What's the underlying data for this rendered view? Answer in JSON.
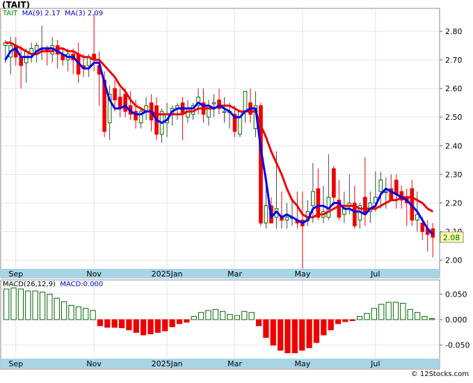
{
  "title": "(TAIT)",
  "price_legend": {
    "ticker": "TAIT",
    "ma_long_label": "MA(9)",
    "ma_long_value": "2.17",
    "ma_short_label": "MA(3)",
    "ma_short_value": "2.09"
  },
  "macd_legend": {
    "label": "MACD(26,12,9)",
    "value_label": "MACD:0.000"
  },
  "last_price": "2.08",
  "credit": "© 12Stocks.com",
  "colors": {
    "up": "#006600",
    "down": "#ee0000",
    "ma_short": "#0000ee",
    "ma_long": "#ee0000",
    "axis_band": "#a8d4e6",
    "label_box": "#ffffaa"
  },
  "chart_data": [
    {
      "type": "candlestick",
      "title": "(TAIT)",
      "ylim": [
        1.97,
        2.88
      ],
      "yticks": [
        "2.80",
        "2.70",
        "2.60",
        "2.50",
        "2.40",
        "2.30",
        "2.20",
        "2.10",
        "2.00"
      ],
      "xticks": [
        "Sep",
        "Nov",
        "2025Jan",
        "Mar",
        "May",
        "Jul"
      ],
      "xtick_index": [
        2,
        17,
        31,
        44,
        57,
        71
      ],
      "candles": [
        [
          2.75,
          2.77,
          2.69,
          2.76
        ],
        [
          2.71,
          2.78,
          2.65,
          2.75
        ],
        [
          2.75,
          2.78,
          2.68,
          2.71
        ],
        [
          2.71,
          2.75,
          2.6,
          2.68
        ],
        [
          2.69,
          2.74,
          2.62,
          2.73
        ],
        [
          2.72,
          2.76,
          2.69,
          2.74
        ],
        [
          2.72,
          2.76,
          2.69,
          2.75
        ],
        [
          2.74,
          2.82,
          2.7,
          2.74
        ],
        [
          2.74,
          2.75,
          2.68,
          2.73
        ],
        [
          2.72,
          2.78,
          2.69,
          2.75
        ],
        [
          2.75,
          2.77,
          2.67,
          2.72
        ],
        [
          2.72,
          2.74,
          2.68,
          2.7
        ],
        [
          2.7,
          2.74,
          2.66,
          2.72
        ],
        [
          2.72,
          2.74,
          2.65,
          2.7
        ],
        [
          2.72,
          2.76,
          2.62,
          2.65
        ],
        [
          2.68,
          2.72,
          2.64,
          2.67
        ],
        [
          2.68,
          2.72,
          2.64,
          2.71
        ],
        [
          2.72,
          2.86,
          2.66,
          2.7
        ],
        [
          2.68,
          2.73,
          2.54,
          2.65
        ],
        [
          2.63,
          2.66,
          2.43,
          2.45
        ],
        [
          2.48,
          2.61,
          2.42,
          2.58
        ],
        [
          2.6,
          2.63,
          2.52,
          2.56
        ],
        [
          2.57,
          2.6,
          2.5,
          2.53
        ],
        [
          2.58,
          2.6,
          2.5,
          2.52
        ],
        [
          2.54,
          2.59,
          2.49,
          2.51
        ],
        [
          2.52,
          2.56,
          2.46,
          2.49
        ],
        [
          2.48,
          2.53,
          2.46,
          2.52
        ],
        [
          2.52,
          2.57,
          2.49,
          2.54
        ],
        [
          2.55,
          2.58,
          2.45,
          2.49
        ],
        [
          2.54,
          2.57,
          2.42,
          2.44
        ],
        [
          2.44,
          2.53,
          2.41,
          2.52
        ],
        [
          2.48,
          2.55,
          2.43,
          2.51
        ],
        [
          2.51,
          2.54,
          2.47,
          2.53
        ],
        [
          2.53,
          2.55,
          2.49,
          2.54
        ],
        [
          2.55,
          2.57,
          2.42,
          2.51
        ],
        [
          2.5,
          2.56,
          2.48,
          2.53
        ],
        [
          2.51,
          2.55,
          2.49,
          2.54
        ],
        [
          2.54,
          2.6,
          2.51,
          2.57
        ],
        [
          2.55,
          2.6,
          2.48,
          2.51
        ],
        [
          2.5,
          2.56,
          2.47,
          2.54
        ],
        [
          2.55,
          2.58,
          2.5,
          2.55
        ],
        [
          2.56,
          2.6,
          2.51,
          2.53
        ],
        [
          2.52,
          2.57,
          2.48,
          2.52
        ],
        [
          2.52,
          2.55,
          2.46,
          2.52
        ],
        [
          2.51,
          2.54,
          2.43,
          2.45
        ],
        [
          2.44,
          2.52,
          2.43,
          2.52
        ],
        [
          2.52,
          2.59,
          2.48,
          2.59
        ],
        [
          2.55,
          2.6,
          2.48,
          2.51
        ],
        [
          2.46,
          2.59,
          2.43,
          2.54
        ],
        [
          2.54,
          2.55,
          2.12,
          2.13
        ],
        [
          2.13,
          2.3,
          2.11,
          2.19
        ],
        [
          2.19,
          2.22,
          2.13,
          2.13
        ],
        [
          2.15,
          2.38,
          2.11,
          2.18
        ],
        [
          2.15,
          2.24,
          2.11,
          2.14
        ],
        [
          2.14,
          2.2,
          2.11,
          2.15
        ],
        [
          2.15,
          2.21,
          2.12,
          2.15
        ],
        [
          2.14,
          2.24,
          2.11,
          2.13
        ],
        [
          2.14,
          2.24,
          1.97,
          2.12
        ],
        [
          2.14,
          2.21,
          2.12,
          2.17
        ],
        [
          2.19,
          2.34,
          2.13,
          2.24
        ],
        [
          2.25,
          2.32,
          2.14,
          2.15
        ],
        [
          2.15,
          2.26,
          2.13,
          2.17
        ],
        [
          2.15,
          2.37,
          2.14,
          2.22
        ],
        [
          2.32,
          2.33,
          2.19,
          2.22
        ],
        [
          2.21,
          2.28,
          2.14,
          2.15
        ],
        [
          2.16,
          2.24,
          2.13,
          2.18
        ],
        [
          2.19,
          2.3,
          2.16,
          2.2
        ],
        [
          2.2,
          2.26,
          2.11,
          2.12
        ],
        [
          2.14,
          2.2,
          2.11,
          2.19
        ],
        [
          2.22,
          2.36,
          2.12,
          2.16
        ],
        [
          2.17,
          2.24,
          2.13,
          2.2
        ],
        [
          2.2,
          2.31,
          2.17,
          2.22
        ],
        [
          2.24,
          2.31,
          2.18,
          2.28
        ],
        [
          2.24,
          2.29,
          2.18,
          2.24
        ],
        [
          2.25,
          2.3,
          2.21,
          2.21
        ],
        [
          2.28,
          2.3,
          2.18,
          2.23
        ],
        [
          2.24,
          2.26,
          2.18,
          2.21
        ],
        [
          2.22,
          2.25,
          2.12,
          2.2
        ],
        [
          2.25,
          2.28,
          2.12,
          2.14
        ],
        [
          2.14,
          2.24,
          2.1,
          2.16
        ],
        [
          2.13,
          2.15,
          2.07,
          2.1
        ],
        [
          2.11,
          2.14,
          2.03,
          2.09
        ],
        [
          2.11,
          2.13,
          2.01,
          2.08
        ]
      ],
      "ma_short": [
        2.7,
        2.73,
        2.74,
        2.71,
        2.71,
        2.71,
        2.73,
        2.74,
        2.74,
        2.74,
        2.73,
        2.72,
        2.71,
        2.71,
        2.69,
        2.67,
        2.67,
        2.69,
        2.69,
        2.62,
        2.56,
        2.53,
        2.53,
        2.54,
        2.52,
        2.51,
        2.51,
        2.52,
        2.52,
        2.49,
        2.48,
        2.49,
        2.52,
        2.53,
        2.53,
        2.53,
        2.53,
        2.55,
        2.54,
        2.54,
        2.53,
        2.54,
        2.53,
        2.52,
        2.5,
        2.5,
        2.52,
        2.53,
        2.53,
        2.39,
        2.28,
        2.15,
        2.17,
        2.15,
        2.16,
        2.15,
        2.14,
        2.13,
        2.14,
        2.18,
        2.19,
        2.19,
        2.18,
        2.2,
        2.2,
        2.18,
        2.18,
        2.17,
        2.17,
        2.16,
        2.18,
        2.19,
        2.23,
        2.25,
        2.24,
        2.23,
        2.22,
        2.21,
        2.19,
        2.17,
        2.14,
        2.11,
        2.09
      ],
      "ma_long": [
        2.76,
        2.76,
        2.75,
        2.74,
        2.73,
        2.72,
        2.72,
        2.73,
        2.73,
        2.73,
        2.74,
        2.74,
        2.73,
        2.73,
        2.72,
        2.71,
        2.71,
        2.7,
        2.7,
        2.68,
        2.66,
        2.64,
        2.61,
        2.59,
        2.56,
        2.54,
        2.53,
        2.52,
        2.52,
        2.51,
        2.51,
        2.51,
        2.51,
        2.51,
        2.51,
        2.52,
        2.52,
        2.53,
        2.53,
        2.53,
        2.53,
        2.54,
        2.54,
        2.54,
        2.53,
        2.52,
        2.52,
        2.52,
        2.52,
        2.47,
        2.43,
        2.38,
        2.34,
        2.3,
        2.25,
        2.21,
        2.19,
        2.16,
        2.15,
        2.15,
        2.16,
        2.16,
        2.17,
        2.18,
        2.19,
        2.19,
        2.19,
        2.19,
        2.18,
        2.18,
        2.18,
        2.18,
        2.19,
        2.2,
        2.21,
        2.21,
        2.22,
        2.22,
        2.22,
        2.21,
        2.2,
        2.18,
        2.17
      ]
    },
    {
      "type": "bar",
      "title": "MACD(26,12,9)",
      "ylim": [
        -0.075,
        0.075
      ],
      "yticks": [
        "0.050",
        "0.000",
        "-0.050"
      ],
      "values": [
        0.06,
        0.062,
        0.06,
        0.056,
        0.056,
        0.054,
        0.05,
        0.042,
        0.035,
        0.028,
        0.025,
        0.022,
        0.018,
        -0.012,
        -0.015,
        -0.015,
        -0.016,
        -0.02,
        -0.025,
        -0.03,
        -0.028,
        -0.025,
        -0.022,
        -0.014,
        -0.008,
        -0.005,
        0.006,
        0.014,
        0.018,
        0.02,
        0.016,
        0.01,
        0.008,
        0.016,
        0.014,
        -0.012,
        -0.035,
        -0.05,
        -0.06,
        -0.065,
        -0.065,
        -0.06,
        -0.055,
        -0.045,
        -0.03,
        -0.02,
        -0.008,
        -0.004,
        -0.002,
        0.006,
        0.012,
        0.022,
        0.03,
        0.034,
        0.034,
        0.032,
        0.02,
        0.014,
        0.006,
        0.002
      ]
    }
  ]
}
